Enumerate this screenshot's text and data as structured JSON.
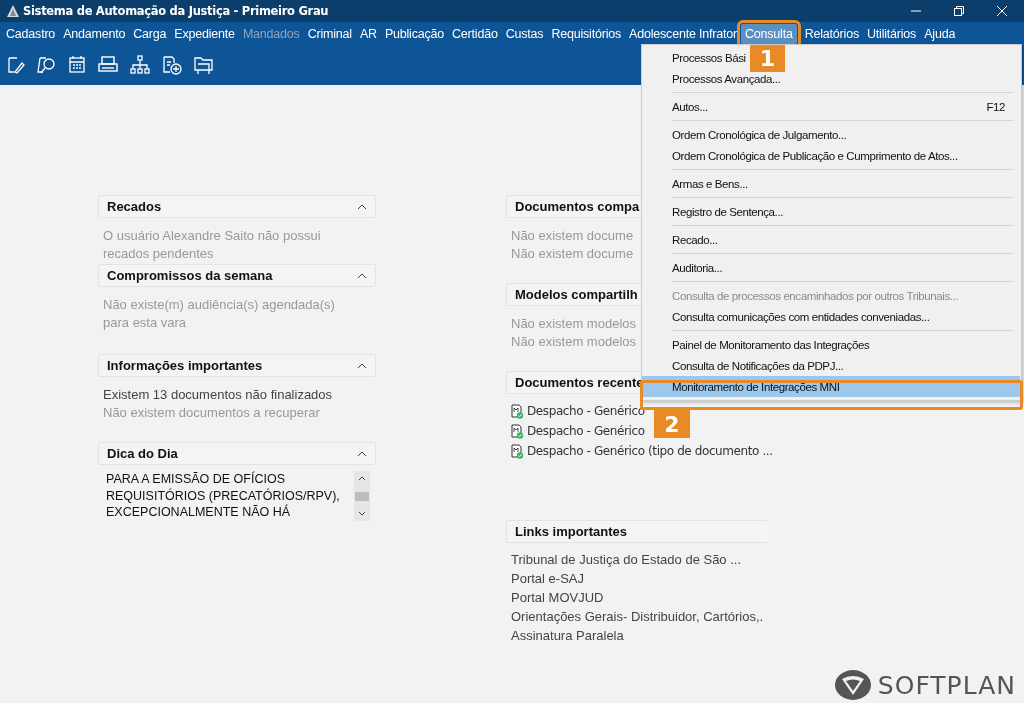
{
  "window": {
    "title": "Sistema de Automação da Justiça - Primeiro Grau"
  },
  "menu_bar": [
    {
      "label": "Cadastro",
      "disabled": false,
      "selected": false
    },
    {
      "label": "Andamento",
      "disabled": false,
      "selected": false
    },
    {
      "label": "Carga",
      "disabled": false,
      "selected": false
    },
    {
      "label": "Expediente",
      "disabled": false,
      "selected": false
    },
    {
      "label": "Mandados",
      "disabled": true,
      "selected": false
    },
    {
      "label": "Criminal",
      "disabled": false,
      "selected": false
    },
    {
      "label": "AR",
      "disabled": false,
      "selected": false
    },
    {
      "label": "Publicação",
      "disabled": false,
      "selected": false
    },
    {
      "label": "Certidão",
      "disabled": false,
      "selected": false
    },
    {
      "label": "Custas",
      "disabled": false,
      "selected": false
    },
    {
      "label": "Requisitórios",
      "disabled": false,
      "selected": false
    },
    {
      "label": "Adolescente Infrator",
      "disabled": false,
      "selected": false
    },
    {
      "label": "Consulta",
      "disabled": false,
      "selected": true
    },
    {
      "label": "Relatórios",
      "disabled": false,
      "selected": false
    },
    {
      "label": "Utilitários",
      "disabled": false,
      "selected": false
    },
    {
      "label": "Ajuda",
      "disabled": false,
      "selected": false
    }
  ],
  "dropdown": [
    {
      "kind": "item",
      "label": "Processos Bási",
      "disabled": false,
      "selected": false
    },
    {
      "kind": "item",
      "label": "Processos Avançada...",
      "disabled": false,
      "selected": false
    },
    {
      "kind": "separator"
    },
    {
      "kind": "item",
      "label": "Autos...",
      "shortcut": "F12",
      "disabled": false,
      "selected": false
    },
    {
      "kind": "separator"
    },
    {
      "kind": "item",
      "label": "Ordem Cronológica de Julgamento...",
      "disabled": false,
      "selected": false
    },
    {
      "kind": "item",
      "label": "Ordem Cronológica de Publicação e Cumprimento de Atos...",
      "disabled": false,
      "selected": false
    },
    {
      "kind": "separator"
    },
    {
      "kind": "item",
      "label": "Armas e Bens...",
      "disabled": false,
      "selected": false
    },
    {
      "kind": "separator"
    },
    {
      "kind": "item",
      "label": "Registro de Sentença...",
      "disabled": false,
      "selected": false
    },
    {
      "kind": "separator"
    },
    {
      "kind": "item",
      "label": "Recado...",
      "disabled": false,
      "selected": false
    },
    {
      "kind": "separator"
    },
    {
      "kind": "item",
      "label": "Auditoria...",
      "disabled": false,
      "selected": false
    },
    {
      "kind": "separator"
    },
    {
      "kind": "item",
      "label": "Consulta de processos encaminhados por outros Tribunais...",
      "disabled": true,
      "selected": false
    },
    {
      "kind": "item",
      "label": "Consulta comunicações com entidades conveniadas...",
      "disabled": false,
      "selected": false
    },
    {
      "kind": "separator"
    },
    {
      "kind": "item",
      "label": "Painel de Monitoramento das Integrações",
      "disabled": false,
      "selected": false
    },
    {
      "kind": "item",
      "label": "Consulta de Notificações da PDPJ...",
      "disabled": false,
      "selected": false
    },
    {
      "kind": "item",
      "label": "Monitoramento de Integrações MNI",
      "disabled": false,
      "selected": true
    }
  ],
  "left_panels": [
    {
      "title": "Recados",
      "expanded": true,
      "lines": [
        {
          "text": "O usuário Alexandre Saito não possui recados pendentes",
          "muted": true
        }
      ]
    },
    {
      "title": "Compromissos da semana",
      "expanded": true,
      "lines": [
        {
          "text": "Não existe(m) audiência(s) agendada(s) para esta vara",
          "muted": true
        }
      ]
    },
    {
      "title": "Informações importantes",
      "expanded": true,
      "lines": [
        {
          "text": "Existem 13 documentos não finalizados",
          "muted": false
        },
        {
          "text": "Não existem documentos a recuperar",
          "muted": true
        }
      ]
    },
    {
      "title": "Dica do Dia",
      "expanded": true,
      "tip": "PARA A EMISSÃO DE OFÍCIOS REQUISITÓRIOS (PRECATÓRIOS/RPV), EXCEPCIONALMENTE NÃO HÁ"
    }
  ],
  "right_panels": [
    {
      "title": "Documentos compa",
      "lines": [
        {
          "text": "Não existem docume",
          "muted": true
        },
        {
          "text": "Não existem docume",
          "muted": true
        }
      ]
    },
    {
      "title": "Modelos compartilh",
      "lines": [
        {
          "text": "Não existem modelos",
          "muted": true
        },
        {
          "text": "Não existem modelos",
          "muted": true
        }
      ]
    },
    {
      "title": "Documentos recente",
      "documents": [
        "Despacho - Genérico",
        "Despacho - Genérico",
        "Despacho - Genérico (tipo de documento ..."
      ]
    }
  ],
  "links_panel": {
    "title": "Links importantes",
    "links": [
      "Tribunal de Justiça do Estado de São ...",
      "Portal e-SAJ",
      "Portal MOVJUD",
      "Orientações Gerais- Distribuidor, Cartórios,.",
      "Assinatura Paralela"
    ]
  },
  "annotations": [
    "1",
    "2"
  ],
  "logo": {
    "text": "SOFTPLAN"
  }
}
